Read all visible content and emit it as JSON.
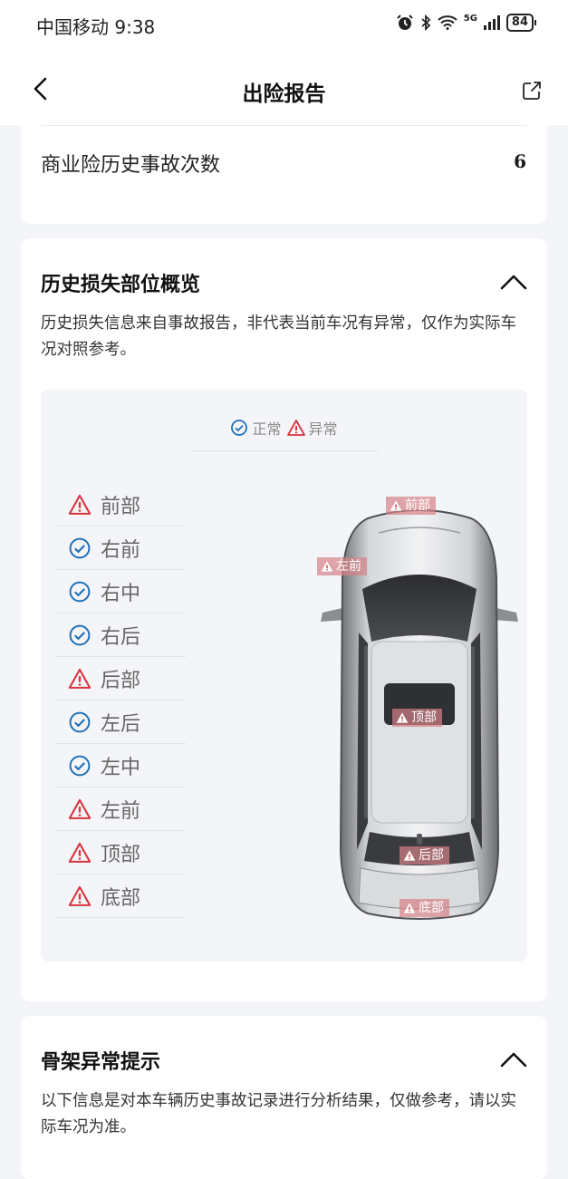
{
  "status_bar": {
    "carrier_time": "中国移动 9:38",
    "network": "5G",
    "battery": "84"
  },
  "nav": {
    "title": "出险报告"
  },
  "commercial_insurance": {
    "label": "商业险历史事故次数",
    "value": "6"
  },
  "damage_overview": {
    "title": "历史损失部位概览",
    "description": "历史损失信息来自事故报告，非代表当前车况有异常，仅作为实际车况对照参考。",
    "legend": {
      "normal": "正常",
      "abnormal": "异常"
    },
    "parts": [
      {
        "name": "前部",
        "status": "abnormal"
      },
      {
        "name": "右前",
        "status": "normal"
      },
      {
        "name": "右中",
        "status": "normal"
      },
      {
        "name": "右后",
        "status": "normal"
      },
      {
        "name": "后部",
        "status": "abnormal"
      },
      {
        "name": "左后",
        "status": "normal"
      },
      {
        "name": "左中",
        "status": "normal"
      },
      {
        "name": "左前",
        "status": "abnormal"
      },
      {
        "name": "顶部",
        "status": "abnormal"
      },
      {
        "name": "底部",
        "status": "abnormal"
      }
    ],
    "car_labels": {
      "front": "前部",
      "left_front": "左前",
      "top": "顶部",
      "rear": "后部",
      "bottom": "底部"
    }
  },
  "frame_abnormal": {
    "title": "骨架异常提示",
    "description": "以下信息是对本车辆历史事故记录进行分析结果，仅做参考，请以实际车况为准。"
  },
  "colors": {
    "normal": "#1f6fb8",
    "abnormal": "#d9343e",
    "panel_bg": "#f4f5f8"
  }
}
